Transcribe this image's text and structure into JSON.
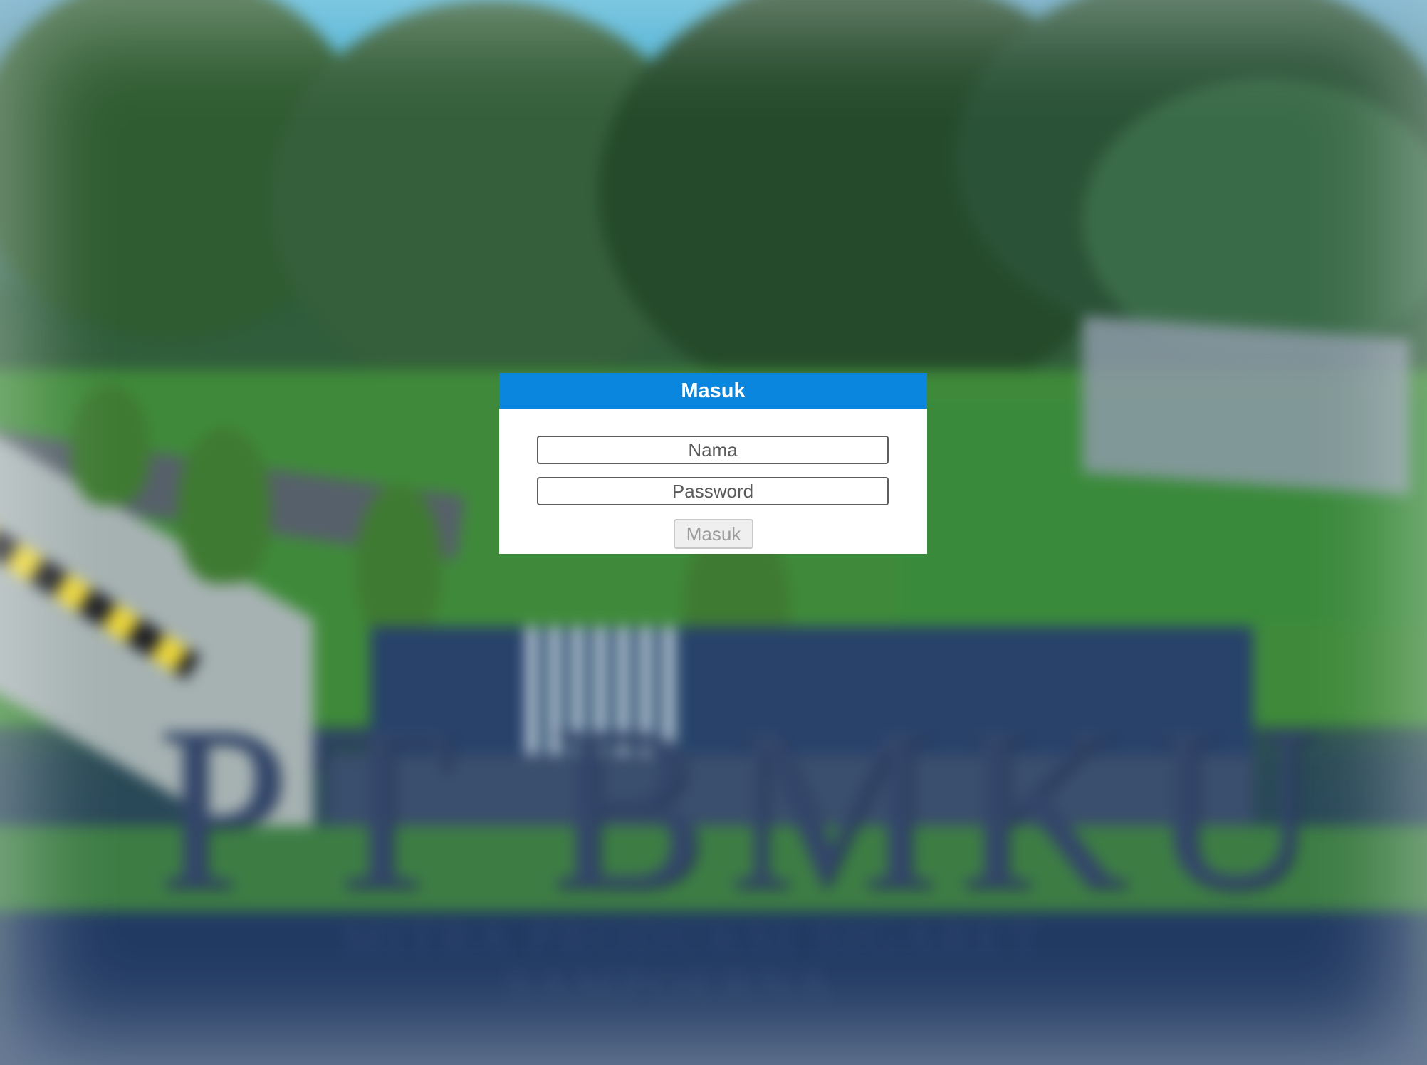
{
  "login": {
    "title": "Masuk",
    "fields": {
      "name_placeholder": "Nama",
      "password_placeholder": "Password"
    },
    "submit_label": "Masuk"
  },
  "background": {
    "sign_main": "PT BMKU",
    "sign_line1": "MITRA PRODUKSI SIGARET",
    "sign_line2": "SAMPOERNA"
  },
  "colors": {
    "header": "#0a86de",
    "header_text": "#ffffff",
    "panel": "#ffffff"
  }
}
